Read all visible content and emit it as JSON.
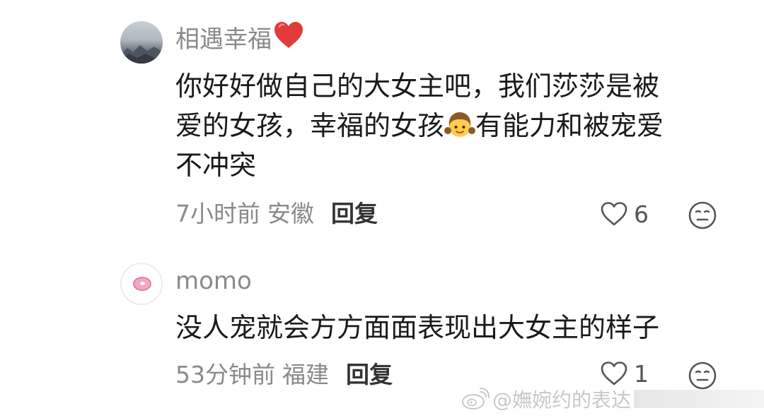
{
  "comments": [
    {
      "username": "相遇幸福",
      "text_lines": [
        "你好好做自己的大女主吧，我们莎莎是被",
        "爱的女孩，幸福的女孩",
        "有能力和被宠爱",
        "不冲突"
      ],
      "time": "7小时前",
      "region": "安徽",
      "reply_label": "回复",
      "likes": "6"
    },
    {
      "username": "momo",
      "text": "没人宠就会方方面面表现出大女主的样子",
      "time": "53分钟前",
      "region": "福建",
      "reply_label": "回复",
      "likes": "1"
    }
  ],
  "watermark": {
    "text": "@嫵婉约的表达",
    "logo": "weibo-logo-icon"
  },
  "icons": {
    "heart_emoji": "red-heart-emoji-icon",
    "girl_emoji": "girl-emoji-icon",
    "like": "heart-outline-icon",
    "dislike": "neutral-face-icon"
  },
  "colors": {
    "meta_gray": "#8a8a8a",
    "text_dark": "#1a1a1a",
    "heart_red": "#e23b3b"
  }
}
